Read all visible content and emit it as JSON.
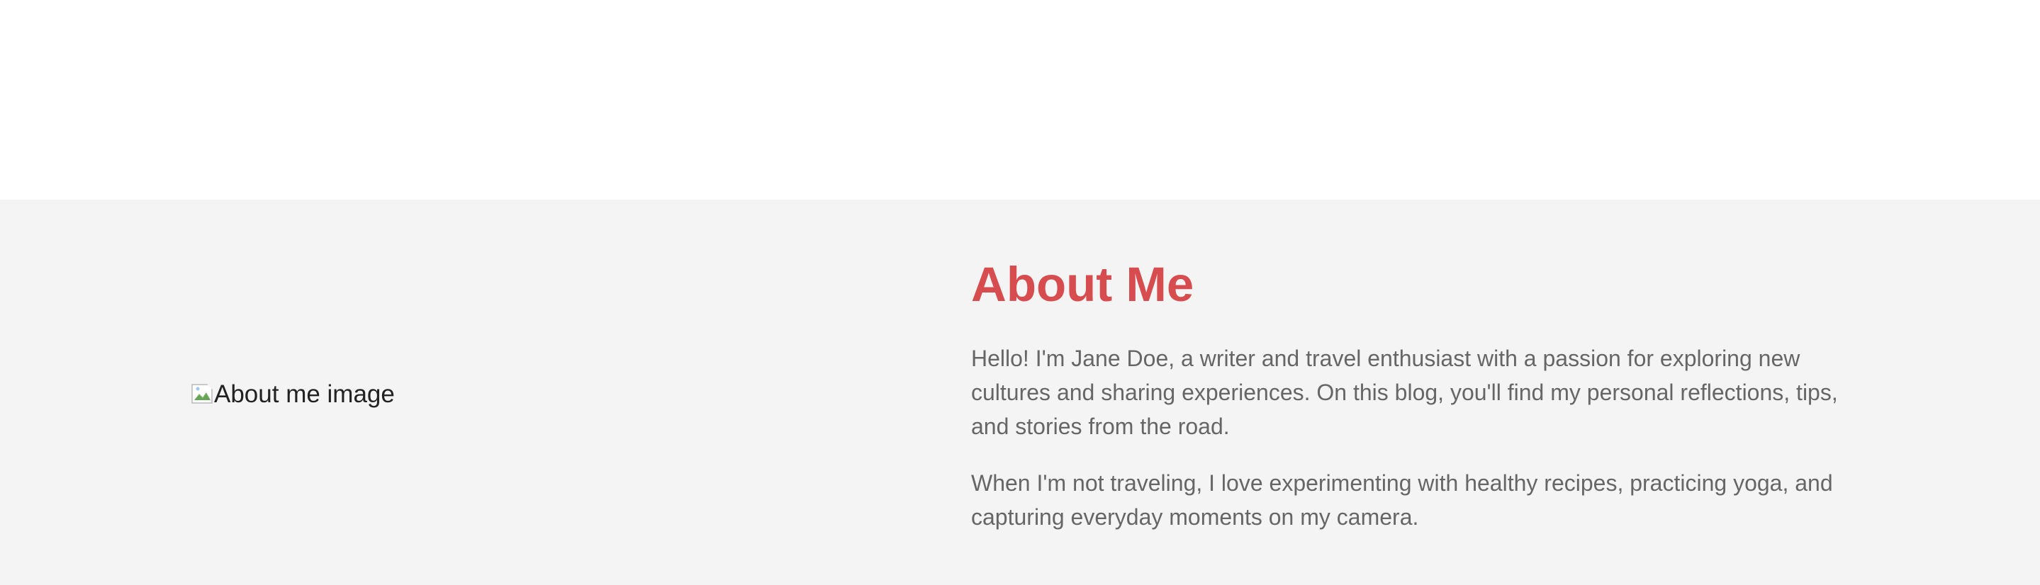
{
  "about": {
    "image_alt": "About me image",
    "title": "About Me",
    "paragraphs": [
      "Hello! I'm Jane Doe, a writer and travel enthusiast with a passion for exploring new cultures and sharing experiences. On this blog, you'll find my personal reflections, tips, and stories from the road.",
      "When I'm not traveling, I love experimenting with healthy recipes, practicing yoga, and capturing everyday moments on my camera."
    ]
  },
  "colors": {
    "section_background": "#f4f4f4",
    "title": "#d64c4f",
    "body_text": "#666666"
  },
  "icons": {
    "image": "broken-image-icon"
  }
}
